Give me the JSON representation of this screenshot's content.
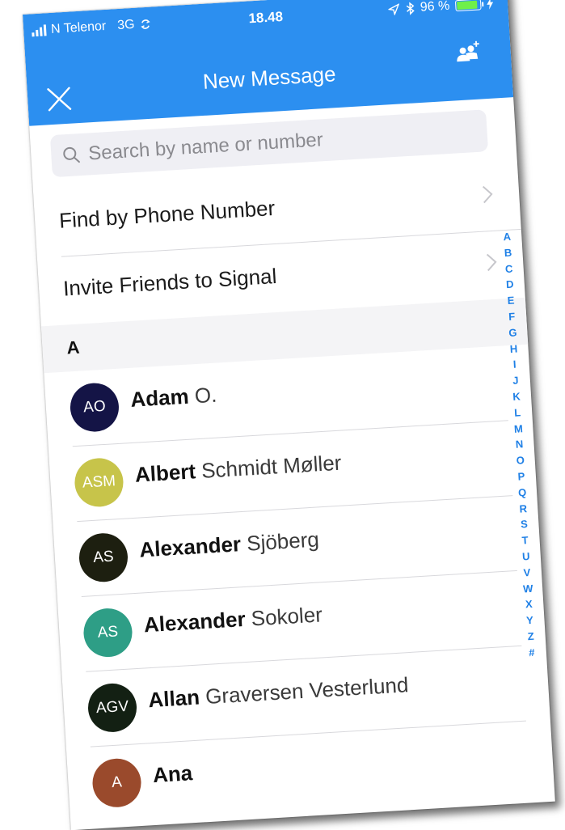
{
  "status_bar": {
    "carrier": "N Telenor",
    "network": "3G",
    "time": "18.48",
    "battery_percent": "96 %",
    "battery_level": 0.96
  },
  "header": {
    "title": "New Message",
    "close_icon": "close-icon",
    "group_icon": "new-group-icon",
    "background": "#2c8ff0"
  },
  "search": {
    "placeholder": "Search by name or number"
  },
  "actions": [
    {
      "label": "Find by Phone Number"
    },
    {
      "label": "Invite Friends to Signal"
    }
  ],
  "section_header": "A",
  "contacts": [
    {
      "initials": "AO",
      "first": "Adam",
      "last": "O.",
      "color": "#141446"
    },
    {
      "initials": "ASM",
      "first": "Albert",
      "last": "Schmidt Møller",
      "color": "#c7c44a"
    },
    {
      "initials": "AS",
      "first": "Alexander",
      "last": "Sjöberg",
      "color": "#1d1f10"
    },
    {
      "initials": "AS",
      "first": "Alexander",
      "last": "Sokoler",
      "color": "#2e9e86"
    },
    {
      "initials": "AGV",
      "first": "Allan",
      "last": "Graversen Vesterlund",
      "color": "#132013"
    },
    {
      "initials": "A",
      "first": "Ana",
      "last": "",
      "color": "#9a4a2c"
    }
  ],
  "index_letters": [
    "A",
    "B",
    "C",
    "D",
    "E",
    "F",
    "G",
    "H",
    "I",
    "J",
    "K",
    "L",
    "M",
    "N",
    "O",
    "P",
    "Q",
    "R",
    "S",
    "T",
    "U",
    "V",
    "W",
    "X",
    "Y",
    "Z",
    "#"
  ]
}
